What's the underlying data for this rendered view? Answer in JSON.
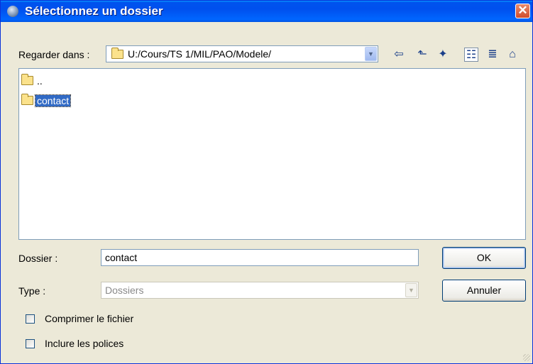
{
  "window": {
    "title": "Sélectionnez un dossier",
    "close_label": "✕"
  },
  "lookin": {
    "label": "Regarder dans :",
    "path": "U:/Cours/TS 1/MIL/PAO/Modele/"
  },
  "toolbar": {
    "icons": [
      "back-icon",
      "up-folder-icon",
      "new-folder-icon",
      "list-view-icon",
      "details-view-icon",
      "home-icon"
    ],
    "active": "list-view-icon"
  },
  "files": [
    {
      "name": "..",
      "selected": false
    },
    {
      "name": "contact",
      "selected": true
    }
  ],
  "folder_field": {
    "label": "Dossier :",
    "value": "contact"
  },
  "type_field": {
    "label": "Type :",
    "value": "Dossiers"
  },
  "buttons": {
    "ok": "OK",
    "cancel": "Annuler"
  },
  "options": [
    {
      "label": "Comprimer le fichier",
      "checked": false
    },
    {
      "label": "Inclure les polices",
      "checked": false
    }
  ],
  "colors": {
    "titlebar": "#0053ee",
    "selection": "#316ac5",
    "background": "#ece9d8"
  }
}
